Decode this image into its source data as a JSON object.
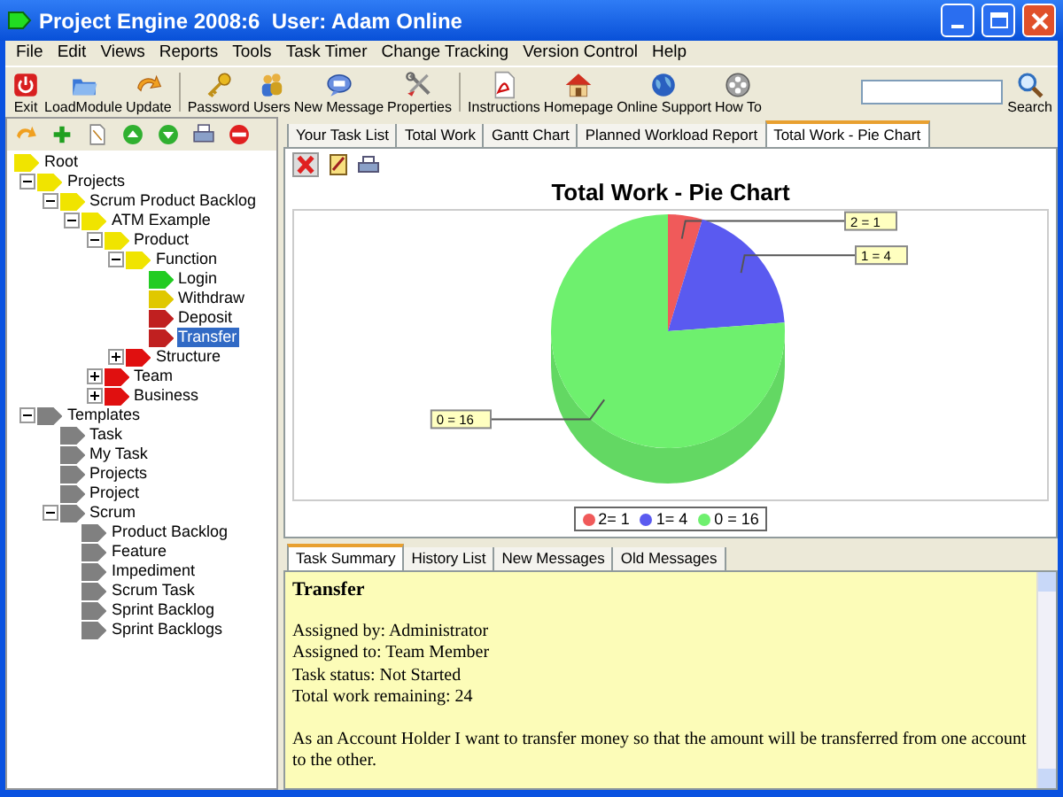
{
  "window": {
    "title": "Project Engine 2008:6  User: Adam Online"
  },
  "menu": [
    "File",
    "Edit",
    "Views",
    "Reports",
    "Tools",
    "Task Timer",
    "Change Tracking",
    "Version Control",
    "Help"
  ],
  "toolbar": [
    {
      "label": "Exit",
      "kind": "power"
    },
    {
      "label": "LoadModule",
      "kind": "folder"
    },
    {
      "label": "Update",
      "kind": "update"
    },
    {
      "kind": "separator"
    },
    {
      "label": "Password",
      "kind": "key"
    },
    {
      "label": "Users",
      "kind": "users"
    },
    {
      "label": "New Message",
      "kind": "message"
    },
    {
      "label": "Properties",
      "kind": "tools"
    },
    {
      "kind": "separator"
    },
    {
      "label": "Instructions",
      "kind": "document"
    },
    {
      "label": "Homepage",
      "kind": "home"
    },
    {
      "label": "Online Support",
      "kind": "globe"
    },
    {
      "label": "How To",
      "kind": "reel"
    }
  ],
  "search": {
    "button": "Search"
  },
  "tree": [
    {
      "label": "Root",
      "color": "#f0e400",
      "selected": false,
      "children": [
        {
          "label": "Projects",
          "color": "#f0e400",
          "selected": false,
          "expanded": true,
          "children": [
            {
              "label": "Scrum Product Backlog",
              "color": "#f0e400",
              "selected": false,
              "expanded": true,
              "children": [
                {
                  "label": "ATM Example",
                  "color": "#f0e400",
                  "selected": false,
                  "expanded": true,
                  "children": [
                    {
                      "label": "Product",
                      "color": "#f0e400",
                      "selected": false,
                      "expanded": true,
                      "children": [
                        {
                          "label": "Function",
                          "color": "#f0e400",
                          "selected": false,
                          "expanded": true,
                          "children": [
                            {
                              "label": "Login",
                              "color": "#22cc22",
                              "selected": false
                            },
                            {
                              "label": "Withdraw",
                              "color": "#e0c800",
                              "selected": false
                            },
                            {
                              "label": "Deposit",
                              "color": "#c02020",
                              "selected": false
                            },
                            {
                              "label": "Transfer",
                              "color": "#c02020",
                              "selected": true
                            }
                          ]
                        },
                        {
                          "label": "Structure",
                          "color": "#e01010",
                          "selected": false,
                          "expanded": false
                        }
                      ]
                    },
                    {
                      "label": "Team",
                      "color": "#e01010",
                      "selected": false,
                      "expanded": false
                    },
                    {
                      "label": "Business",
                      "color": "#e01010",
                      "selected": false,
                      "expanded": false
                    }
                  ]
                }
              ]
            }
          ]
        },
        {
          "label": "Templates",
          "color": "#808080",
          "selected": false,
          "expanded": true,
          "children": [
            {
              "label": "Task",
              "color": "#808080",
              "selected": false
            },
            {
              "label": "My Task",
              "color": "#808080",
              "selected": false
            },
            {
              "label": "Projects",
              "color": "#808080",
              "selected": false
            },
            {
              "label": "Project",
              "color": "#808080",
              "selected": false
            },
            {
              "label": "Scrum",
              "color": "#808080",
              "selected": false,
              "expanded": true,
              "children": [
                {
                  "label": "Product Backlog",
                  "color": "#808080",
                  "selected": false
                },
                {
                  "label": "Feature",
                  "color": "#808080",
                  "selected": false
                },
                {
                  "label": "Impediment",
                  "color": "#808080",
                  "selected": false
                },
                {
                  "label": "Scrum Task",
                  "color": "#808080",
                  "selected": false
                },
                {
                  "label": "Sprint Backlog",
                  "color": "#808080",
                  "selected": false
                },
                {
                  "label": "Sprint Backlogs",
                  "color": "#808080",
                  "selected": false
                }
              ]
            }
          ]
        }
      ]
    }
  ],
  "tabs": [
    {
      "label": "Your Task List",
      "selected": false
    },
    {
      "label": "Total Work",
      "selected": false
    },
    {
      "label": "Gantt Chart",
      "selected": false
    },
    {
      "label": "Planned Workload Report",
      "selected": false
    },
    {
      "label": "Total Work - Pie Chart",
      "selected": true
    }
  ],
  "chart": {
    "legend": [
      {
        "label": "2= 1",
        "color": "#f05a5a"
      },
      {
        "label": "1= 4",
        "color": "#5a5af0"
      },
      {
        "label": "0 = 16",
        "color": "#6ef06e"
      }
    ],
    "chart_data": {
      "type": "pie",
      "title": "Total Work - Pie Chart",
      "categories": [
        "2 = 1",
        "1 = 4",
        "0 = 16"
      ],
      "values": [
        1,
        4,
        16
      ]
    }
  },
  "bottom_tabs": [
    {
      "label": "Task Summary",
      "selected": true
    },
    {
      "label": "History List",
      "selected": false
    },
    {
      "label": "New Messages",
      "selected": false
    },
    {
      "label": "Old Messages",
      "selected": false
    }
  ],
  "summary": {
    "title": "Transfer",
    "lines": [
      "Assigned by: Administrator",
      "Assigned to: Team Member",
      "Task status: Not Started",
      "Total work remaining: 24"
    ],
    "description": "As an Account Holder I want to transfer money so that the amount will be transferred from one account to the other."
  }
}
